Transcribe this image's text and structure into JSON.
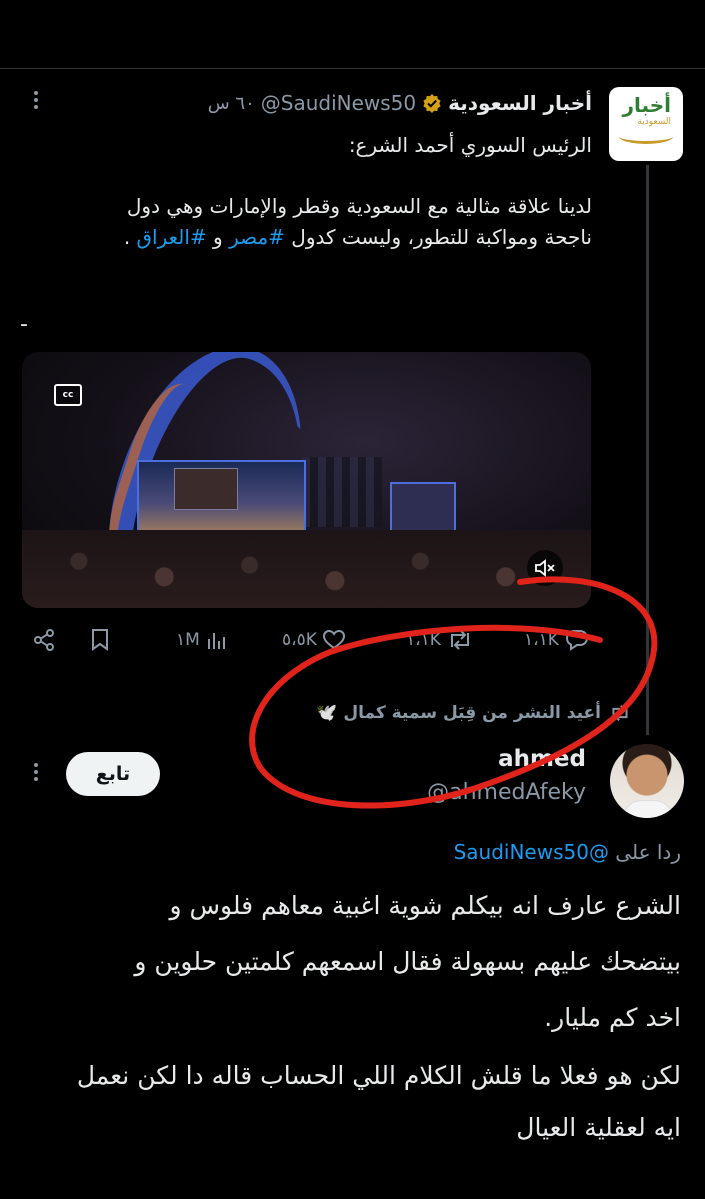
{
  "tweet": {
    "author_name": "أخبار السعودية",
    "handle": "@SaudiNews50",
    "time": "٦٠ س",
    "avatar_word": "أخبار",
    "avatar_sub": "السعودية",
    "text_line1": "الرئيس السوري أحمد الشرع:",
    "text_line2": "لدينا علاقة مثالية مع السعودية وقطر والإمارات وهي دول",
    "text_line3_a": "ناجحة ومواكبة للتطور، وليست كدول ",
    "hashtag_1": "#مصر",
    "text_line3_b": " و ",
    "hashtag_2": "#العراق",
    "text_line3_c": " .",
    "dash": "-",
    "video": {
      "cc_label": "cc"
    },
    "actions": {
      "replies": "١،١K",
      "reposts": "١،١K",
      "likes": "٥،٥K",
      "views": "١M"
    },
    "verified_color": "#d4a017",
    "link_color": "#1d9bf0"
  },
  "repost_banner": {
    "text": "أعيد النشر من قِبَل سمية كمال 🕊️"
  },
  "reply": {
    "author_name": "ahmed",
    "handle": "@ahmedAfeky",
    "follow_label": "تابع",
    "replying_label": "ردا على",
    "replying_to": "@SaudiNews50",
    "line1": "الشرع عارف انه بيكلم شوية اغبية معاهم فلوس و",
    "line2": "بيتضحك عليهم بسهولة فقال اسمعهم كلمتين حلوين و",
    "line3": "اخد كم مليار.",
    "line4": "لكن هو فعلا ما قلش الكلام اللي الحساب قاله دا لكن نعمل",
    "line5": "ايه لعقلية العيال"
  },
  "annotation_color": "#e0231b"
}
